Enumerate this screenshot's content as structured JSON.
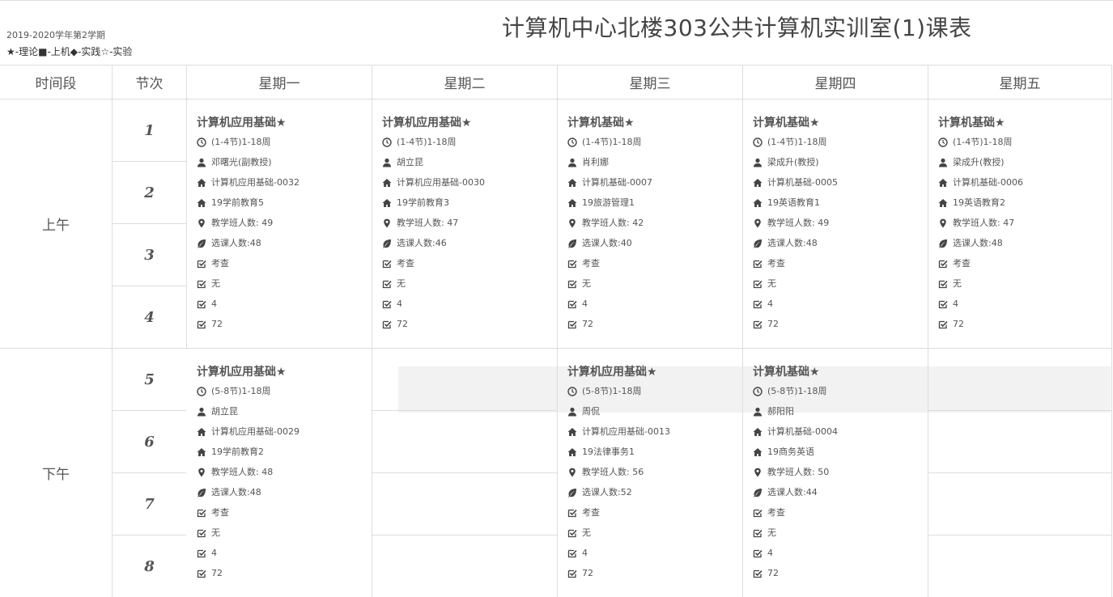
{
  "header": {
    "term": "2019-2020学年第2学期",
    "legend": "★-理论■-上机◆-实践☆-实验",
    "title": "计算机中心北楼303公共计算机实训室(1)课表"
  },
  "columns": {
    "time": "时间段",
    "section": "节次",
    "days": [
      "星期一",
      "星期二",
      "星期三",
      "星期四",
      "星期五"
    ]
  },
  "periods": {
    "morning": "上午",
    "afternoon": "下午"
  },
  "sections": [
    "1",
    "2",
    "3",
    "4",
    "5",
    "6",
    "7",
    "8"
  ],
  "courses": {
    "mon_am": {
      "name": "计算机应用基础★",
      "time": "(1-4节)1-18周",
      "teacher": "邓曙光(副教授)",
      "class_code": "计算机应用基础-0032",
      "group": "19学前教育5",
      "class_size": "教学班人数: 49",
      "enrolled": "选课人数:48",
      "assess": "考查",
      "note": "无",
      "credit": "4",
      "hours": "72"
    },
    "tue_am": {
      "name": "计算机应用基础★",
      "time": "(1-4节)1-18周",
      "teacher": "胡立昆",
      "class_code": "计算机应用基础-0030",
      "group": "19学前教育3",
      "class_size": "教学班人数: 47",
      "enrolled": "选课人数:46",
      "assess": "考查",
      "note": "无",
      "credit": "4",
      "hours": "72"
    },
    "wed_am": {
      "name": "计算机基础★",
      "time": "(1-4节)1-18周",
      "teacher": "肖利娜",
      "class_code": "计算机基础-0007",
      "group": "19旅游管理1",
      "class_size": "教学班人数: 42",
      "enrolled": "选课人数:40",
      "assess": "考查",
      "note": "无",
      "credit": "4",
      "hours": "72"
    },
    "thu_am": {
      "name": "计算机基础★",
      "time": "(1-4节)1-18周",
      "teacher": "梁成升(教授)",
      "class_code": "计算机基础-0005",
      "group": "19英语教育1",
      "class_size": "教学班人数: 49",
      "enrolled": "选课人数:48",
      "assess": "考查",
      "note": "无",
      "credit": "4",
      "hours": "72"
    },
    "fri_am": {
      "name": "计算机基础★",
      "time": "(1-4节)1-18周",
      "teacher": "梁成升(教授)",
      "class_code": "计算机基础-0006",
      "group": "19英语教育2",
      "class_size": "教学班人数: 47",
      "enrolled": "选课人数:48",
      "assess": "考查",
      "note": "无",
      "credit": "4",
      "hours": "72"
    },
    "mon_pm": {
      "name": "计算机应用基础★",
      "time": "(5-8节)1-18周",
      "teacher": "胡立昆",
      "class_code": "计算机应用基础-0029",
      "group": "19学前教育2",
      "class_size": "教学班人数: 48",
      "enrolled": "选课人数:48",
      "assess": "考查",
      "note": "无",
      "credit": "4",
      "hours": "72"
    },
    "wed_pm": {
      "name": "计算机应用基础★",
      "time": "(5-8节)1-18周",
      "teacher": "周侃",
      "class_code": "计算机应用基础-0013",
      "group": "19法律事务1",
      "class_size": "教学班人数: 56",
      "enrolled": "选课人数:52",
      "assess": "考查",
      "note": "无",
      "credit": "4",
      "hours": "72"
    },
    "thu_pm": {
      "name": "计算机基础★",
      "time": "(5-8节)1-18周",
      "teacher": "郝阳阳",
      "class_code": "计算机基础-0004",
      "group": "19商务英语",
      "class_size": "教学班人数: 50",
      "enrolled": "选课人数:44",
      "assess": "考查",
      "note": "无",
      "credit": "4",
      "hours": "72"
    }
  },
  "icons": [
    "clock-icon",
    "user-icon",
    "home-icon",
    "map-pin-icon",
    "leaf-icon",
    "check-square-icon"
  ],
  "colors": {
    "grid": "#dddddd",
    "text": "#444444",
    "shade": "#f2f2f2"
  }
}
